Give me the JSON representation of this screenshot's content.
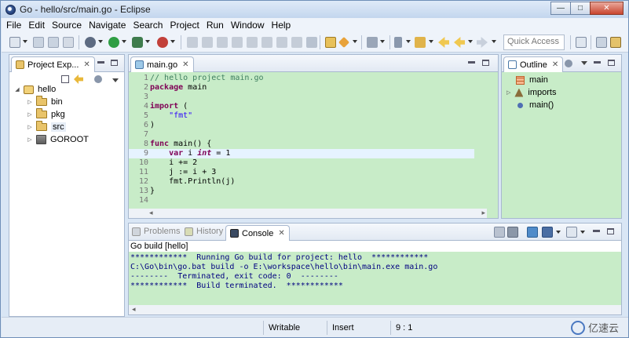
{
  "window": {
    "title": "Go - hello/src/main.go - Eclipse"
  },
  "window_controls": {
    "minimize": "—",
    "maximize": "□",
    "close": "✕"
  },
  "menubar": [
    "File",
    "Edit",
    "Source",
    "Navigate",
    "Search",
    "Project",
    "Run",
    "Window",
    "Help"
  ],
  "toolbar": {
    "quick_access_placeholder": "Quick Access"
  },
  "explorer": {
    "tab_label": "Project Exp...",
    "close": "✕",
    "tree": [
      {
        "label": "hello",
        "level": 0,
        "expanded": true,
        "icon": "project-icon"
      },
      {
        "label": "bin",
        "level": 1,
        "expanded": false,
        "icon": "folder-icon"
      },
      {
        "label": "pkg",
        "level": 1,
        "expanded": false,
        "icon": "folder-icon"
      },
      {
        "label": "src",
        "level": 1,
        "expanded": false,
        "icon": "folder-icon"
      },
      {
        "label": "GOROOT",
        "level": 1,
        "expanded": false,
        "icon": "library-icon"
      }
    ]
  },
  "editor": {
    "tab_label": "main.go",
    "close": "✕",
    "current_line": 9,
    "lines": [
      {
        "n": "1",
        "html": "<span class=\"cm\">// hello project main.go</span>"
      },
      {
        "n": "2",
        "html": "<span class=\"kw\">package</span> main"
      },
      {
        "n": "3",
        "html": ""
      },
      {
        "n": "4",
        "html": "<span class=\"kw\">import</span> ("
      },
      {
        "n": "5",
        "html": "    <span class=\"st\">\"fmt\"</span>"
      },
      {
        "n": "6",
        "html": ")"
      },
      {
        "n": "7",
        "html": ""
      },
      {
        "n": "8",
        "html": "<span class=\"kw\">func</span> main() {"
      },
      {
        "n": "9",
        "html": "    <span class=\"kw\">var</span> i <span class=\"it\">int</span> = 1"
      },
      {
        "n": "10",
        "html": "    i += 2"
      },
      {
        "n": "11",
        "html": "    j := i + 3"
      },
      {
        "n": "12",
        "html": "    fmt.Println(j)"
      },
      {
        "n": "13",
        "html": "}"
      },
      {
        "n": "14",
        "html": ""
      }
    ]
  },
  "outline": {
    "tab_label": "Outline",
    "close": "✕",
    "items": [
      {
        "label": "main",
        "icon": "package-icon",
        "twisty": ""
      },
      {
        "label": "imports",
        "icon": "imports-icon",
        "twisty": "▷"
      },
      {
        "label": "main()",
        "icon": "function-icon",
        "twisty": ""
      }
    ]
  },
  "bottom": {
    "tabs": [
      {
        "label": "Problems",
        "active": false
      },
      {
        "label": "History",
        "active": false
      },
      {
        "label": "Console",
        "active": true
      }
    ],
    "close": "✕",
    "console_header": "Go build [hello]",
    "console_lines": [
      "************  Running Go build for project: hello  ************",
      "C:\\Go\\bin\\go.bat build -o E:\\workspace\\hello\\bin\\main.exe main.go",
      "--------  Terminated, exit code: 0  --------",
      "************  Build terminated.  ************"
    ]
  },
  "statusbar": {
    "writable": "Writable",
    "insert": "Insert",
    "position": "9 : 1"
  },
  "watermark": {
    "text": "亿速云"
  }
}
